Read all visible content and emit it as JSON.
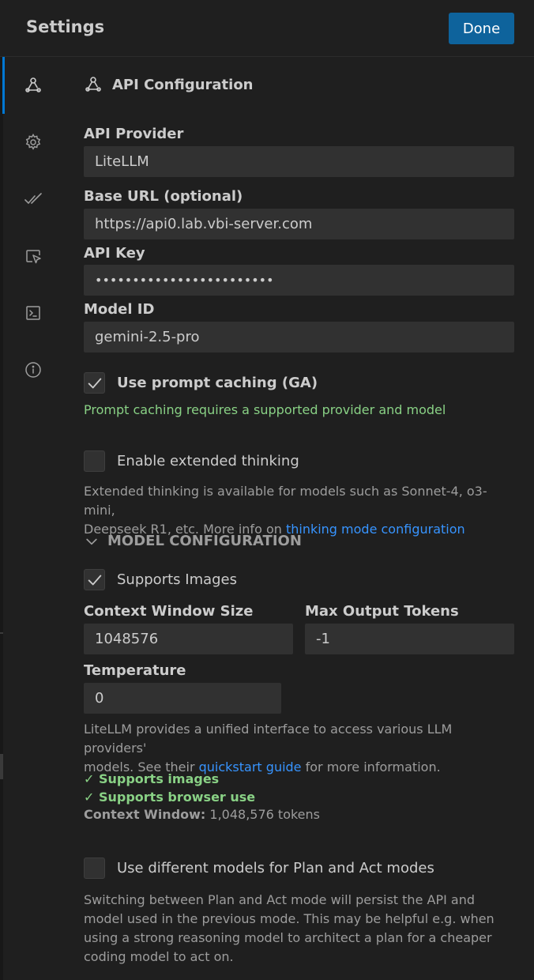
{
  "header": {
    "title": "Settings",
    "done_label": "Done"
  },
  "sidebar": {
    "items": [
      {
        "name": "api-configuration",
        "icon": "webhook-icon"
      },
      {
        "name": "general",
        "icon": "gear-icon"
      },
      {
        "name": "features",
        "icon": "check-all-icon"
      },
      {
        "name": "browser",
        "icon": "inspect-icon"
      },
      {
        "name": "terminal",
        "icon": "terminal-icon"
      },
      {
        "name": "about",
        "icon": "info-icon"
      }
    ]
  },
  "section": {
    "title": "API Configuration",
    "icon": "webhook-icon"
  },
  "form": {
    "provider": {
      "label": "API Provider",
      "value": "LiteLLM"
    },
    "base_url": {
      "label": "Base URL (optional)",
      "value": "https://api0.lab.vbi-server.com"
    },
    "api_key": {
      "label": "API Key",
      "value": "••••••••••••••••••••••••"
    },
    "model_id": {
      "label": "Model ID",
      "value": "gemini-2.5-pro"
    },
    "prompt_caching": {
      "label": "Use prompt caching (GA)",
      "checked": true,
      "note": "Prompt caching requires a supported provider and model"
    },
    "extended_thinking": {
      "label": "Enable extended thinking",
      "checked": false,
      "note_line1": "Extended thinking is available for models such as Sonnet-4, o3-mini,",
      "note_line2_prefix": "Deepseek R1, etc. More info on ",
      "note_link": "thinking mode configuration"
    }
  },
  "model_config": {
    "header": "MODEL CONFIGURATION",
    "supports_images": {
      "label": "Supports Images",
      "checked": true
    },
    "context_window": {
      "label": "Context Window Size",
      "value": "1048576"
    },
    "max_output": {
      "label": "Max Output Tokens",
      "value": "-1"
    },
    "temperature": {
      "label": "Temperature",
      "value": "0"
    }
  },
  "info": {
    "line1": "LiteLLM provides a unified interface to access various LLM providers'",
    "line2_prefix": "models. See their ",
    "link": "quickstart guide",
    "line2_suffix": " for more information.",
    "supports_images": "✓ Supports images",
    "supports_browser": "✓ Supports browser use",
    "context_label": "Context Window:",
    "context_value": " 1,048,576 tokens"
  },
  "plan_act": {
    "label": "Use different models for Plan and Act modes",
    "checked": false,
    "note_lines": [
      "Switching between Plan and Act mode will persist the API and",
      "model used in the previous mode. This may be helpful e.g. when",
      "using a strong reasoning model to architect a plan for a cheaper",
      "coding model to act on."
    ]
  },
  "colors": {
    "accent": "#0e639c",
    "active_indicator": "#0078d4",
    "success": "#89d185",
    "link": "#3794ff"
  }
}
